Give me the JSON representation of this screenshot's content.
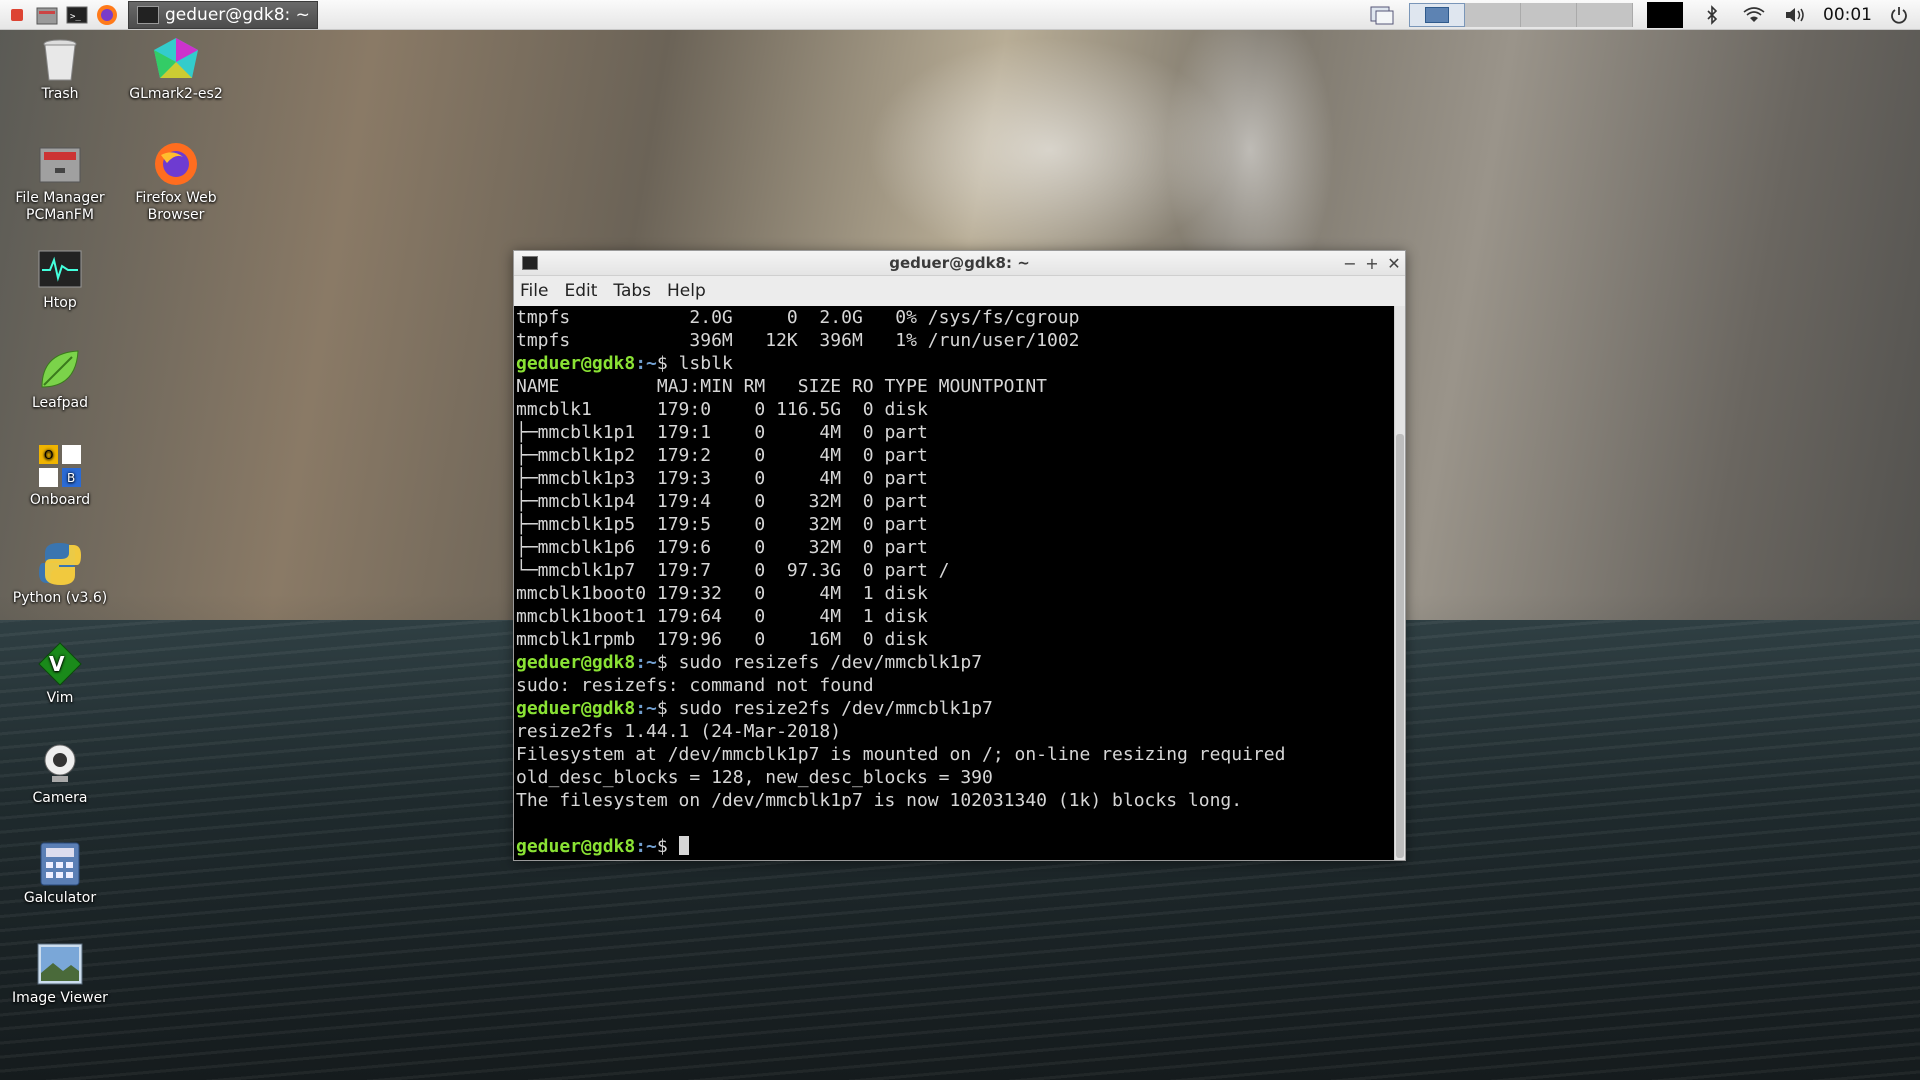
{
  "taskbar": {
    "task_title": "geduer@gdk8: ~",
    "clock": "00:01",
    "launchers": [
      "menu-icon",
      "file-manager-icon",
      "terminal-icon",
      "firefox-icon"
    ],
    "tray": [
      "bluetooth-icon",
      "wifi-icon",
      "volume-icon",
      "power-icon"
    ]
  },
  "desktop": {
    "icons": [
      {
        "label": "Trash",
        "icon": "trash-icon"
      },
      {
        "label": "GLmark2-es2",
        "icon": "glmark-icon"
      },
      {
        "label": "File Manager PCManFM",
        "icon": "file-manager-icon"
      },
      {
        "label": "Firefox Web Browser",
        "icon": "firefox-icon"
      },
      {
        "label": "Htop",
        "icon": "htop-icon"
      },
      {
        "label": "Leafpad",
        "icon": "leafpad-icon"
      },
      {
        "label": "Onboard",
        "icon": "onboard-icon"
      },
      {
        "label": "Python (v3.6)",
        "icon": "python-icon"
      },
      {
        "label": "Vim",
        "icon": "vim-icon"
      },
      {
        "label": "Camera",
        "icon": "camera-icon"
      },
      {
        "label": "Galculator",
        "icon": "calculator-icon"
      },
      {
        "label": "Image Viewer",
        "icon": "image-viewer-icon"
      }
    ]
  },
  "window": {
    "title": "geduer@gdk8: ~",
    "buttons": {
      "minimize": "−",
      "maximize": "+",
      "close": "✕"
    },
    "menu": [
      "File",
      "Edit",
      "Tabs",
      "Help"
    ]
  },
  "terminal": {
    "prompt_user": "geduer@gdk8",
    "prompt_path": ":~",
    "prompt_sign": "$ ",
    "lines": [
      {
        "type": "out",
        "text": "tmpfs           2.0G     0  2.0G   0% /sys/fs/cgroup"
      },
      {
        "type": "out",
        "text": "tmpfs           396M   12K  396M   1% /run/user/1002"
      },
      {
        "type": "cmd",
        "text": "lsblk"
      },
      {
        "type": "out",
        "text": "NAME         MAJ:MIN RM   SIZE RO TYPE MOUNTPOINT"
      },
      {
        "type": "out",
        "text": "mmcblk1      179:0    0 116.5G  0 disk"
      },
      {
        "type": "out",
        "text": "├─mmcblk1p1  179:1    0     4M  0 part"
      },
      {
        "type": "out",
        "text": "├─mmcblk1p2  179:2    0     4M  0 part"
      },
      {
        "type": "out",
        "text": "├─mmcblk1p3  179:3    0     4M  0 part"
      },
      {
        "type": "out",
        "text": "├─mmcblk1p4  179:4    0    32M  0 part"
      },
      {
        "type": "out",
        "text": "├─mmcblk1p5  179:5    0    32M  0 part"
      },
      {
        "type": "out",
        "text": "├─mmcblk1p6  179:6    0    32M  0 part"
      },
      {
        "type": "out",
        "text": "└─mmcblk1p7  179:7    0  97.3G  0 part /"
      },
      {
        "type": "out",
        "text": "mmcblk1boot0 179:32   0     4M  1 disk"
      },
      {
        "type": "out",
        "text": "mmcblk1boot1 179:64   0     4M  1 disk"
      },
      {
        "type": "out",
        "text": "mmcblk1rpmb  179:96   0    16M  0 disk"
      },
      {
        "type": "cmd",
        "text": "sudo resizefs /dev/mmcblk1p7"
      },
      {
        "type": "out",
        "text": "sudo: resizefs: command not found"
      },
      {
        "type": "cmd",
        "text": "sudo resize2fs /dev/mmcblk1p7"
      },
      {
        "type": "out",
        "text": "resize2fs 1.44.1 (24-Mar-2018)"
      },
      {
        "type": "out",
        "text": "Filesystem at /dev/mmcblk1p7 is mounted on /; on-line resizing required"
      },
      {
        "type": "out",
        "text": "old_desc_blocks = 128, new_desc_blocks = 390"
      },
      {
        "type": "out",
        "text": "The filesystem on /dev/mmcblk1p7 is now 102031340 (1k) blocks long."
      },
      {
        "type": "out",
        "text": ""
      },
      {
        "type": "cmd",
        "text": "",
        "cursor": true
      }
    ]
  }
}
